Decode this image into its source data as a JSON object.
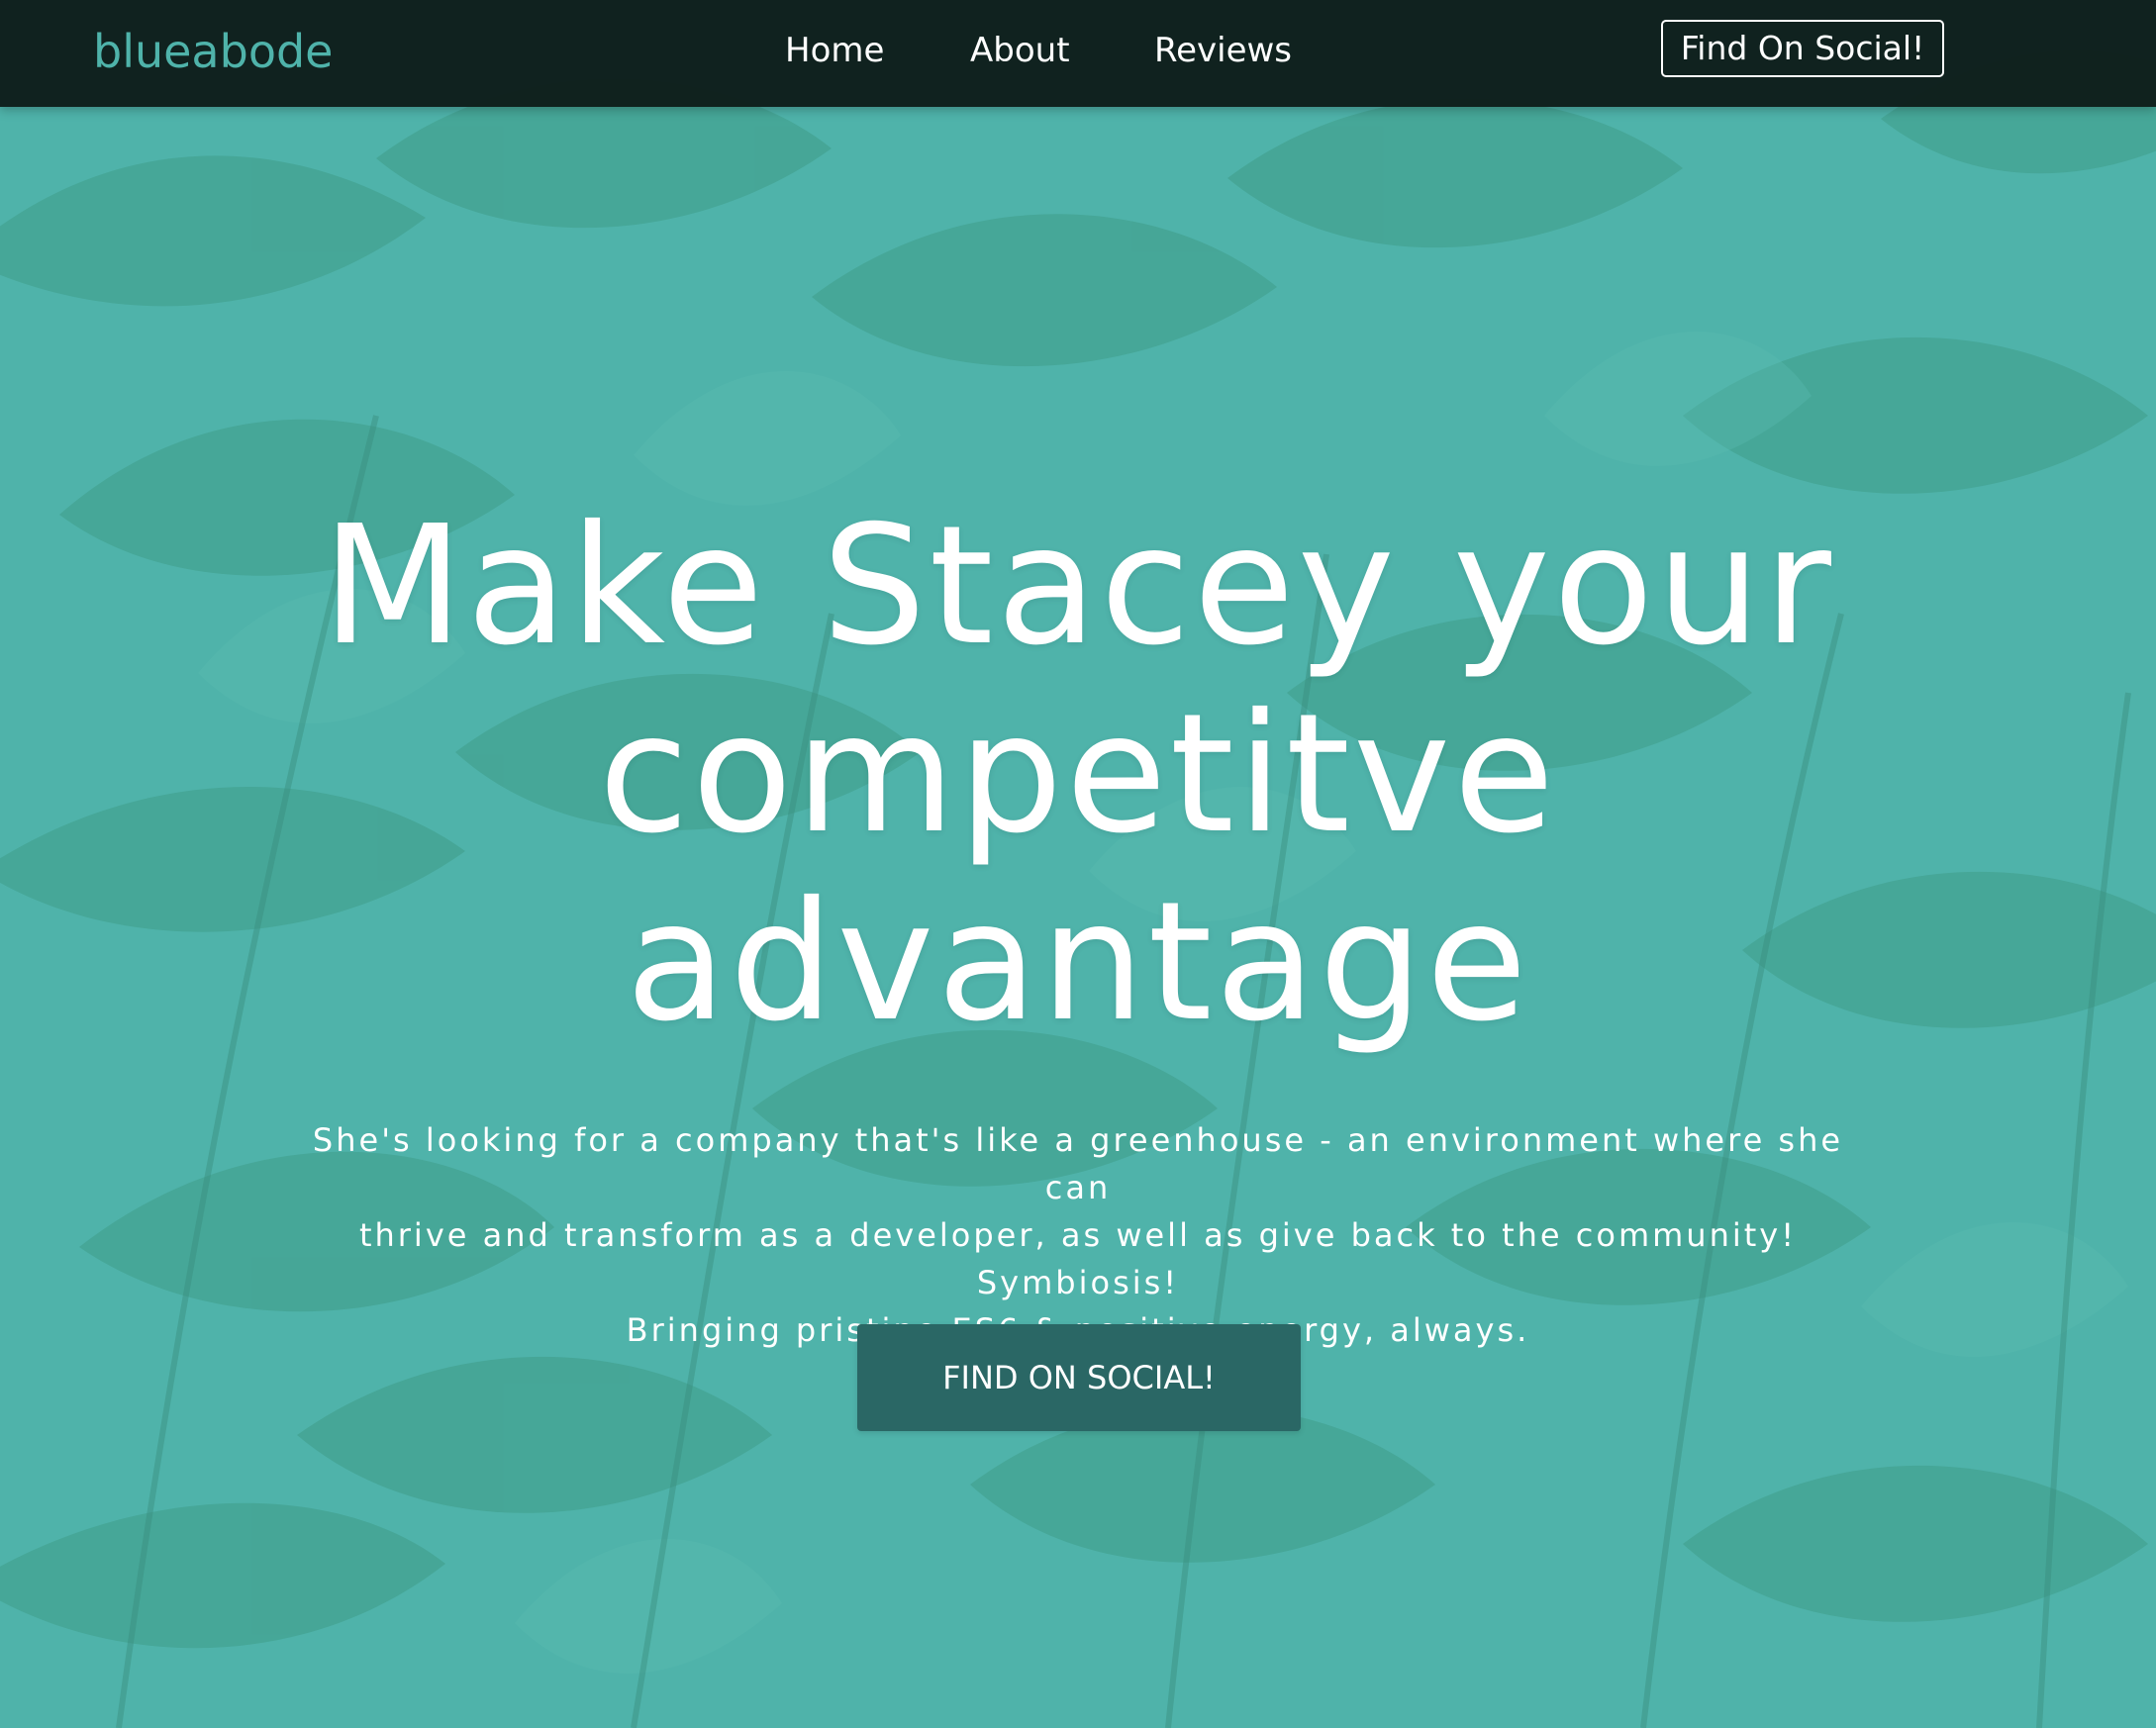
{
  "nav": {
    "brand": "blueabode",
    "links": [
      "Home",
      "About",
      "Reviews"
    ],
    "cta": "Find On Social!"
  },
  "hero": {
    "title_lines": [
      "Make Stacey your",
      "competitve",
      "advantage"
    ],
    "subtitle_lines": [
      "She's looking for a company that's like a greenhouse - an environment where she can",
      "thrive and transform as a developer, as well as give back to the community! Symbiosis!",
      "Bringing pristine ES6 & positive energy, always."
    ],
    "cta": "FIND ON SOCIAL!"
  },
  "colors": {
    "background": "#4fb3aa",
    "leaf": "#3f9c88",
    "navbar": "#0e1c19",
    "brand": "#4fb3aa",
    "cta_bg": "#2a6765",
    "text": "#ffffff"
  }
}
